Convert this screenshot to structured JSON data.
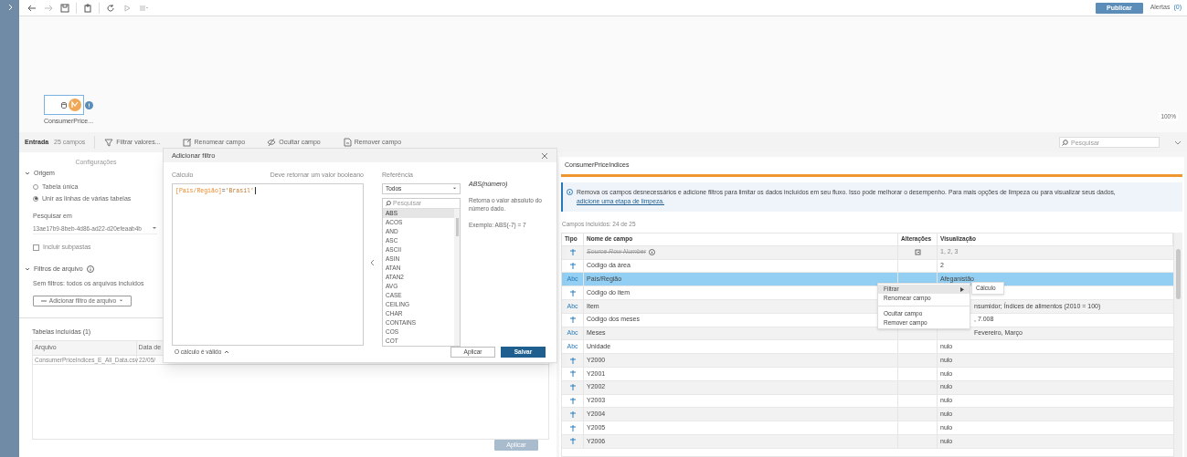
{
  "toolbar": {
    "publish": "Publicar",
    "alerts_label": "Alertas",
    "alerts_count": "(0)"
  },
  "canvas": {
    "node": {
      "label": "ConsumerPrice..."
    },
    "zoom": "100%"
  },
  "step_toolbar": {
    "title": "Entrada",
    "field_count": "25 campos",
    "actions": [
      {
        "kind": "filter",
        "label": "Filtrar valores..."
      },
      {
        "kind": "rename",
        "label": "Renomear campo"
      },
      {
        "kind": "hide",
        "label": "Ocultar campo"
      },
      {
        "kind": "remove",
        "label": "Remover campo"
      }
    ],
    "search": {
      "placeholder": "Pesquisar"
    }
  },
  "settings": {
    "title": "Configurações",
    "origin": {
      "title": "Origem",
      "options": [
        {
          "label": "Tabela única",
          "selected": false
        },
        {
          "label": "Unir as linhas de várias tabelas",
          "selected": true
        }
      ]
    },
    "search_in": {
      "label": "Pesquisar em",
      "value": "13ae17b9-8beb-4d86-ad22-d20efeaab4b"
    },
    "subfolders": {
      "label": "Incluir subpastas",
      "checked": false
    },
    "file_filters": {
      "title": "Filtros de arquivo",
      "note": "Sem filtros: todos os arquivos incluídos",
      "button": "Adicionar filtro de arquivo"
    },
    "tables": {
      "title": "Tabelas incluídas (1)",
      "columns": [
        "Arquivo",
        "Data de"
      ],
      "rows": [
        [
          "ConsumerPriceIndices_E_All_Data.csv",
          "22/05/"
        ]
      ]
    },
    "apply": "Aplicar"
  },
  "dialog": {
    "title": "Adicionar filtro",
    "calc_label": "Cálculo",
    "calc_hint": "Deve retornar um valor booleano",
    "formula": [
      {
        "kind": "field",
        "text": "[País/Região]"
      },
      {
        "kind": "operator",
        "text": "="
      },
      {
        "kind": "string",
        "text": "'Brasil'"
      }
    ],
    "reference": {
      "label": "Referência",
      "category": "Todos",
      "search_placeholder": "Pesquisar",
      "functions": [
        {
          "name": "ABS",
          "selected": true
        },
        {
          "name": "ACOS",
          "selected": false
        },
        {
          "name": "AND",
          "selected": false
        },
        {
          "name": "ASC",
          "selected": false
        },
        {
          "name": "ASCII",
          "selected": false
        },
        {
          "name": "ASIN",
          "selected": false
        },
        {
          "name": "ATAN",
          "selected": false
        },
        {
          "name": "ATAN2",
          "selected": false
        },
        {
          "name": "AVG",
          "selected": false
        },
        {
          "name": "CASE",
          "selected": false
        },
        {
          "name": "CEILING",
          "selected": false
        },
        {
          "name": "CHAR",
          "selected": false
        },
        {
          "name": "CONTAINS",
          "selected": false
        },
        {
          "name": "COS",
          "selected": false
        },
        {
          "name": "COT",
          "selected": false
        }
      ]
    },
    "help": {
      "signature": "ABS(número)",
      "description": "Retorna o valor absoluto do número dado.",
      "example": "Exemplo: ABS(-7) = 7"
    },
    "status": "O cálculo é válido",
    "apply": "Aplicar",
    "save": "Salvar"
  },
  "fields_panel": {
    "title": "ConsumerPriceIndices",
    "banner": {
      "text": "Remova os campos desnecessários e adicione filtros para limitar os dados incluídos em seu fluxo. Isso pode melhorar o desempenho. Para mais opções de limpeza ou para visualizar seus dados, ",
      "link": "adicione uma etapa de limpeza."
    },
    "count": "Campos incluídos: 24 de 25",
    "columns": [
      "Tipo",
      "Nome de campo",
      "Alterações",
      "Visualização"
    ],
    "rows": [
      {
        "kind": "number",
        "name": "Source Row Number",
        "removed": true,
        "changed": true,
        "selected": false,
        "preview": "1, 2, 3",
        "hidden_by_menu": false
      },
      {
        "kind": "number",
        "name": "Código da área",
        "removed": false,
        "changed": false,
        "selected": false,
        "preview": "2",
        "hidden_by_menu": false
      },
      {
        "kind": "string",
        "type_label": "Abc",
        "name": "País/Região",
        "removed": false,
        "changed": false,
        "selected": true,
        "preview": "Afeganistão",
        "hidden_by_menu": false
      },
      {
        "kind": "number",
        "name": "Código do item",
        "removed": false,
        "changed": false,
        "selected": false
      },
      {
        "kind": "string",
        "type_label": "Abc",
        "name": "Item",
        "removed": false,
        "changed": false,
        "selected": false,
        "preview": "nsumidor; Índices de alimentos (2010 = 100)",
        "hidden_by_menu": true
      },
      {
        "kind": "number",
        "name": "Código dos meses",
        "removed": false,
        "changed": false,
        "selected": false,
        "preview": ", 7.008",
        "hidden_by_menu": true
      },
      {
        "kind": "string",
        "type_label": "Abc",
        "name": "Meses",
        "removed": false,
        "changed": false,
        "selected": false,
        "preview": "Fevereiro, Março",
        "hidden_by_menu": true
      },
      {
        "kind": "string",
        "type_label": "Abc",
        "name": "Unidade",
        "removed": false,
        "changed": false,
        "selected": false,
        "preview": "nulo",
        "hidden_by_menu": false
      },
      {
        "kind": "number",
        "name": "Y2000",
        "removed": false,
        "changed": false,
        "selected": false,
        "preview": "nulo",
        "hidden_by_menu": false
      },
      {
        "kind": "number",
        "name": "Y2001",
        "removed": false,
        "changed": false,
        "selected": false,
        "preview": "nulo",
        "hidden_by_menu": false
      },
      {
        "kind": "number",
        "name": "Y2002",
        "removed": false,
        "changed": false,
        "selected": false,
        "preview": "nulo",
        "hidden_by_menu": false
      },
      {
        "kind": "number",
        "name": "Y2003",
        "removed": false,
        "changed": false,
        "selected": false,
        "preview": "nulo",
        "hidden_by_menu": false
      },
      {
        "kind": "number",
        "name": "Y2004",
        "removed": false,
        "changed": false,
        "selected": false,
        "preview": "nulo",
        "hidden_by_menu": false
      },
      {
        "kind": "number",
        "name": "Y2005",
        "removed": false,
        "changed": false,
        "selected": false,
        "preview": "nulo",
        "hidden_by_menu": false
      },
      {
        "kind": "number",
        "name": "Y2006",
        "removed": false,
        "changed": false,
        "selected": false,
        "preview": "nulo",
        "hidden_by_menu": false
      }
    ]
  },
  "context_menu": {
    "items": [
      {
        "kind": "submenu",
        "label": "Filtrar",
        "highlighted": true
      },
      {
        "kind": "item",
        "label": "Renomear campo",
        "highlighted": false
      },
      {
        "kind": "separator"
      },
      {
        "kind": "item",
        "label": "Ocultar campo",
        "highlighted": false
      },
      {
        "kind": "item",
        "label": "Remover campo",
        "highlighted": false
      }
    ],
    "submenu": [
      "Cálculo"
    ]
  }
}
